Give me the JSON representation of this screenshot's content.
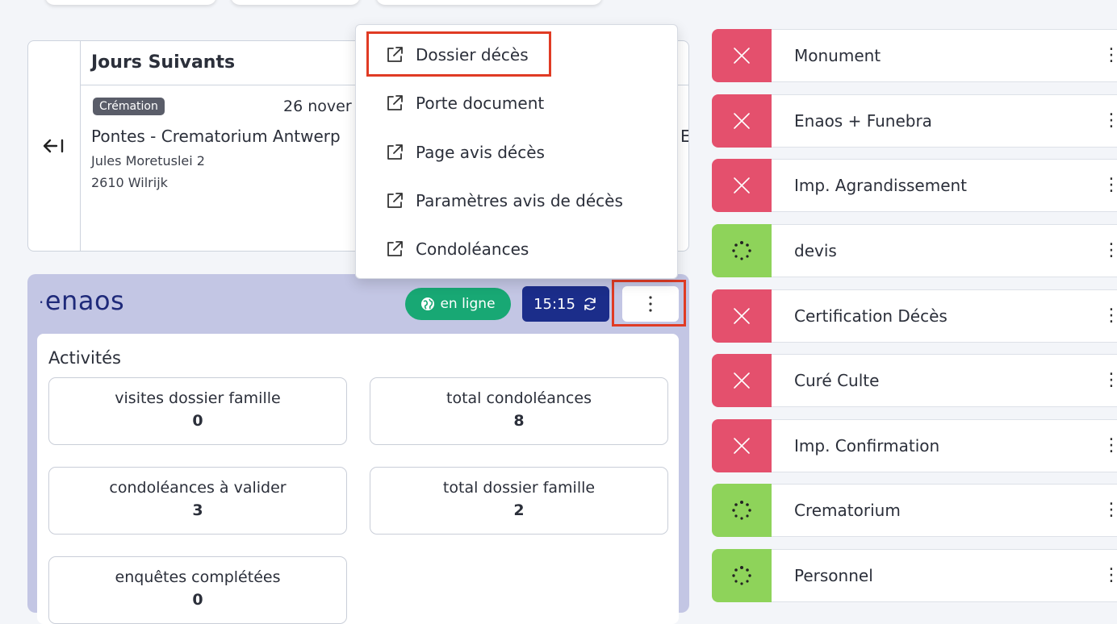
{
  "next_days": {
    "title": "Jours Suivants",
    "back_icon": "arrow-left-bar-icon",
    "event": {
      "tag": "Crémation",
      "date": "26 nover",
      "place": "Pontes - Crematorium Antwerp",
      "address_line1": "Jules Moretuslei 2",
      "address_line2": "2610 Wilrijk",
      "extra": "E"
    }
  },
  "menu": {
    "items": [
      {
        "label": "Dossier décès",
        "icon": "external-link-icon"
      },
      {
        "label": "Porte document",
        "icon": "external-link-icon"
      },
      {
        "label": "Page avis décès",
        "icon": "external-link-icon"
      },
      {
        "label": "Paramètres avis de décès",
        "icon": "external-link-icon"
      },
      {
        "label": "Condoléances",
        "icon": "external-link-icon"
      }
    ]
  },
  "enaos": {
    "logo": "enaos",
    "status": "en ligne",
    "time": "15:15",
    "activities_title": "Activités",
    "stats": [
      {
        "label": "visites dossier famille",
        "value": "0"
      },
      {
        "label": "total condoléances",
        "value": "8"
      },
      {
        "label": "condoléances à valider",
        "value": "3"
      },
      {
        "label": "total dossier famille",
        "value": "2"
      },
      {
        "label": "enquêtes complétées",
        "value": "0"
      }
    ]
  },
  "tasks": [
    {
      "label": "Monument",
      "status": "cancelled",
      "icon": "close-icon",
      "color": "#e4506d"
    },
    {
      "label": "Enaos + Funebra",
      "status": "cancelled",
      "icon": "close-icon",
      "color": "#e4506d"
    },
    {
      "label": "Imp. Agrandissement",
      "status": "cancelled",
      "icon": "close-icon",
      "color": "#e4506d"
    },
    {
      "label": "devis",
      "status": "in-progress",
      "icon": "spinner-icon",
      "color": "#8ed35a"
    },
    {
      "label": "Certification Décès",
      "status": "cancelled",
      "icon": "close-icon",
      "color": "#e4506d"
    },
    {
      "label": "Curé Culte",
      "status": "cancelled",
      "icon": "close-icon",
      "color": "#e4506d"
    },
    {
      "label": "Imp. Confirmation",
      "status": "cancelled",
      "icon": "close-icon",
      "color": "#e4506d"
    },
    {
      "label": "Crematorium",
      "status": "in-progress",
      "icon": "spinner-icon",
      "color": "#8ed35a"
    },
    {
      "label": "Personnel",
      "status": "in-progress",
      "icon": "spinner-icon",
      "color": "#8ed35a"
    }
  ]
}
